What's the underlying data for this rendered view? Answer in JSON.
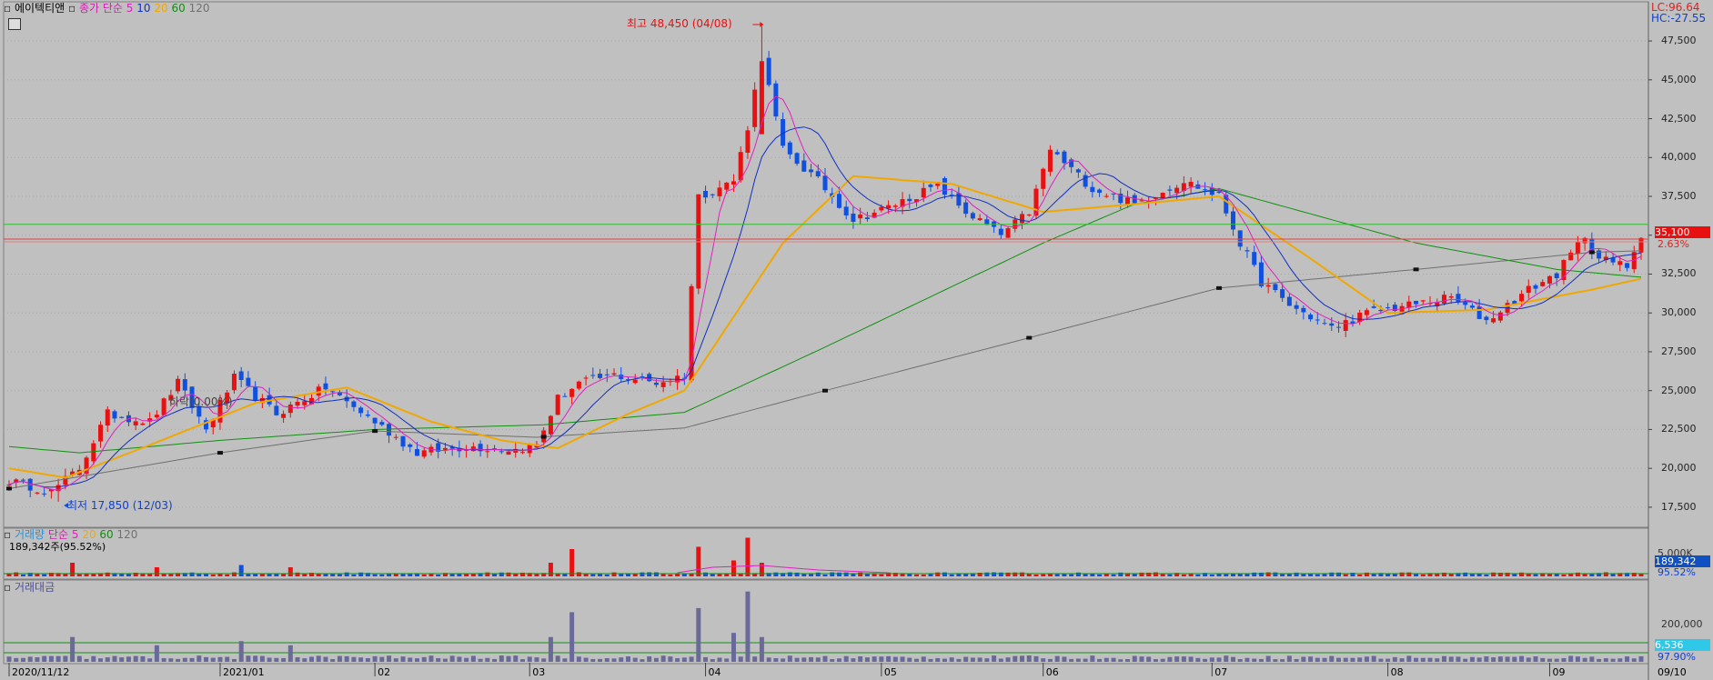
{
  "header": {
    "stock_name": "에이텍티앤",
    "ma_label": "종가 단순",
    "ma_periods": [
      "5",
      "10",
      "20",
      "60",
      "120"
    ],
    "ma_colors": [
      "#e020c0",
      "#1030c0",
      "#f0a800",
      "#109010",
      "#707070"
    ]
  },
  "top_right": {
    "lc": "LC:96.64",
    "hc": "HC:-27.55"
  },
  "price_panel": {
    "y_ticks": [
      "47,500",
      "45,000",
      "42,500",
      "40,000",
      "37,500",
      "35,000",
      "32,500",
      "30,000",
      "27,500",
      "25,000",
      "22,500",
      "20,000",
      "17,500"
    ],
    "current_price": "35,100",
    "change_pct": "2.63%",
    "high_note": "최고 48,450 (04/08)",
    "low_note": "최저 17,850 (12/03)",
    "ghost_note": "하락(0.00%)"
  },
  "volume_panel": {
    "title": "거래량",
    "ma_label": "단순",
    "ma_periods": [
      "5",
      "20",
      "60",
      "120"
    ],
    "summary": "189,342주(95.52%)",
    "y_tick": "5,000K",
    "value_badge": "189,342",
    "pct_badge": "95.52%"
  },
  "amount_panel": {
    "title": "거래대금",
    "y_tick": "200,000",
    "value_badge": "6,536",
    "pct_badge": "97.90%"
  },
  "x_axis": {
    "labels": [
      "2020/11/12",
      "2021/01",
      "02",
      "03",
      "04",
      "05",
      "06",
      "07",
      "08",
      "09"
    ],
    "last_date": "09/10"
  },
  "colors": {
    "up": "#e81010",
    "down": "#1050e0",
    "bg": "#c0c0c0",
    "grid": "#a8a8a8",
    "amount_bar": "#6a6a9a",
    "green_line": "#30c030",
    "red_line": "#e04040"
  },
  "chart_data": {
    "type": "candlestick",
    "ylim": [
      16500,
      49200
    ],
    "anchors": [
      {
        "t": 0,
        "p": 19200
      },
      {
        "t": 6,
        "p": 18500
      },
      {
        "t": 10,
        "p": 20000
      },
      {
        "t": 14,
        "p": 23500
      },
      {
        "t": 20,
        "p": 23000
      },
      {
        "t": 24,
        "p": 25500
      },
      {
        "t": 28,
        "p": 22500
      },
      {
        "t": 32,
        "p": 25800
      },
      {
        "t": 38,
        "p": 23500
      },
      {
        "t": 45,
        "p": 25200
      },
      {
        "t": 52,
        "p": 23000
      },
      {
        "t": 58,
        "p": 21000
      },
      {
        "t": 65,
        "p": 21400
      },
      {
        "t": 72,
        "p": 21200
      },
      {
        "t": 75,
        "p": 21500
      },
      {
        "t": 78,
        "p": 24500
      },
      {
        "t": 81,
        "p": 25500
      },
      {
        "t": 86,
        "p": 26000
      },
      {
        "t": 92,
        "p": 25500
      },
      {
        "t": 96,
        "p": 26000
      },
      {
        "t": 98,
        "p": 37500
      },
      {
        "t": 103,
        "p": 38500
      },
      {
        "t": 105,
        "p": 42000
      },
      {
        "t": 107,
        "p": 46500
      },
      {
        "t": 110,
        "p": 40500
      },
      {
        "t": 115,
        "p": 38500
      },
      {
        "t": 120,
        "p": 36000
      },
      {
        "t": 125,
        "p": 36800
      },
      {
        "t": 132,
        "p": 38200
      },
      {
        "t": 136,
        "p": 36500
      },
      {
        "t": 141,
        "p": 35000
      },
      {
        "t": 145,
        "p": 36500
      },
      {
        "t": 148,
        "p": 40500
      },
      {
        "t": 154,
        "p": 38000
      },
      {
        "t": 160,
        "p": 37000
      },
      {
        "t": 167,
        "p": 38500
      },
      {
        "t": 172,
        "p": 37500
      },
      {
        "t": 175,
        "p": 34500
      },
      {
        "t": 178,
        "p": 32000
      },
      {
        "t": 182,
        "p": 30500
      },
      {
        "t": 188,
        "p": 29000
      },
      {
        "t": 193,
        "p": 30000
      },
      {
        "t": 199,
        "p": 30500
      },
      {
        "t": 205,
        "p": 31000
      },
      {
        "t": 210,
        "p": 29500
      },
      {
        "t": 216,
        "p": 31500
      },
      {
        "t": 220,
        "p": 32500
      },
      {
        "t": 224,
        "p": 35000
      },
      {
        "t": 226,
        "p": 33500
      },
      {
        "t": 230,
        "p": 33000
      },
      {
        "t": 232,
        "p": 35100
      }
    ],
    "vol_spikes": [
      {
        "t": 9,
        "v": 3
      },
      {
        "t": 21,
        "v": 2
      },
      {
        "t": 33,
        "v": 2.5
      },
      {
        "t": 40,
        "v": 2
      },
      {
        "t": 77,
        "v": 3
      },
      {
        "t": 80,
        "v": 6
      },
      {
        "t": 98,
        "v": 6.5
      },
      {
        "t": 103,
        "v": 3.5
      },
      {
        "t": 105,
        "v": 8.5
      },
      {
        "t": 107,
        "v": 3
      }
    ],
    "x_label_t": [
      0,
      30,
      52,
      74,
      99,
      124,
      147,
      171,
      196,
      219
    ],
    "ma_lines": {
      "ma60": [
        {
          "t": 0,
          "p": 21400
        },
        {
          "t": 10,
          "p": 21000
        },
        {
          "t": 30,
          "p": 21800
        },
        {
          "t": 52,
          "p": 22500
        },
        {
          "t": 76,
          "p": 22800
        },
        {
          "t": 96,
          "p": 23600
        },
        {
          "t": 116,
          "p": 27800
        },
        {
          "t": 147,
          "p": 34500
        },
        {
          "t": 160,
          "p": 37000
        },
        {
          "t": 172,
          "p": 38000
        },
        {
          "t": 200,
          "p": 34500
        },
        {
          "t": 220,
          "p": 32800
        },
        {
          "t": 232,
          "p": 32300
        }
      ],
      "ma120": [
        {
          "t": 0,
          "p": 18700
        },
        {
          "t": 30,
          "p": 21000
        },
        {
          "t": 52,
          "p": 22400
        },
        {
          "t": 75,
          "p": 22000
        },
        {
          "t": 96,
          "p": 22600
        },
        {
          "t": 116,
          "p": 25000
        },
        {
          "t": 145,
          "p": 28400
        },
        {
          "t": 172,
          "p": 31600
        },
        {
          "t": 200,
          "p": 32800
        },
        {
          "t": 225,
          "p": 33900
        },
        {
          "t": 232,
          "p": 34000
        }
      ],
      "ma20": [
        {
          "t": 0,
          "p": 20000
        },
        {
          "t": 8,
          "p": 19400
        },
        {
          "t": 20,
          "p": 21500
        },
        {
          "t": 35,
          "p": 24200
        },
        {
          "t": 48,
          "p": 25200
        },
        {
          "t": 60,
          "p": 23000
        },
        {
          "t": 70,
          "p": 21800
        },
        {
          "t": 78,
          "p": 21300
        },
        {
          "t": 88,
          "p": 23500
        },
        {
          "t": 96,
          "p": 25000
        },
        {
          "t": 110,
          "p": 34500
        },
        {
          "t": 120,
          "p": 38800
        },
        {
          "t": 134,
          "p": 38300
        },
        {
          "t": 147,
          "p": 36500
        },
        {
          "t": 160,
          "p": 37000
        },
        {
          "t": 172,
          "p": 37500
        },
        {
          "t": 185,
          "p": 33500
        },
        {
          "t": 196,
          "p": 30000
        },
        {
          "t": 210,
          "p": 30200
        },
        {
          "t": 225,
          "p": 31500
        },
        {
          "t": 232,
          "p": 32200
        }
      ]
    }
  }
}
